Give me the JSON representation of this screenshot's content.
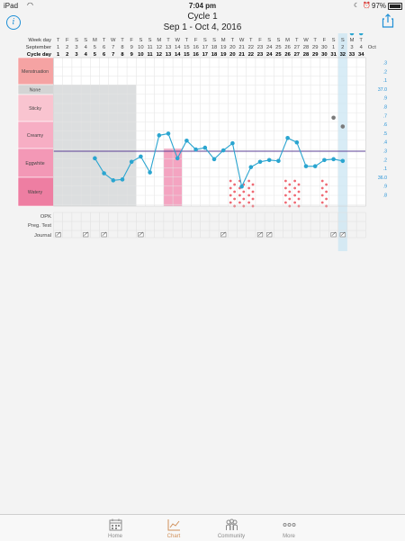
{
  "status_bar": {
    "device": "iPad",
    "time": "7:04 pm",
    "battery": "97%"
  },
  "header": {
    "title": "Cycle 1",
    "subtitle": "Sep 1 - Oct 4, 2016"
  },
  "chart_data": {
    "type": "line",
    "row_labels": {
      "week_day": "Week day",
      "month": "September",
      "cycle_day": "Cycle day"
    },
    "week_days": [
      "T",
      "F",
      "S",
      "S",
      "M",
      "T",
      "W",
      "T",
      "F",
      "S",
      "S",
      "M",
      "T",
      "W",
      "T",
      "F",
      "S",
      "S",
      "M",
      "T",
      "W",
      "T",
      "F",
      "S",
      "S",
      "M",
      "T",
      "W",
      "T",
      "F",
      "S",
      "S",
      "M",
      "T"
    ],
    "dates": [
      "1",
      "2",
      "3",
      "4",
      "5",
      "6",
      "7",
      "8",
      "9",
      "10",
      "11",
      "12",
      "13",
      "14",
      "15",
      "16",
      "17",
      "18",
      "19",
      "20",
      "21",
      "22",
      "23",
      "24",
      "25",
      "26",
      "27",
      "28",
      "29",
      "30",
      "1",
      "2",
      "3",
      "4"
    ],
    "next_month": "Oct",
    "cycle_days": [
      1,
      2,
      3,
      4,
      5,
      6,
      7,
      8,
      9,
      10,
      11,
      12,
      13,
      14,
      15,
      16,
      17,
      18,
      19,
      20,
      21,
      22,
      23,
      24,
      25,
      26,
      27,
      28,
      29,
      30,
      31,
      32,
      33,
      34
    ],
    "highlight_day": 32,
    "observation_categories": [
      "Menstruation",
      "None",
      "Sticky",
      "Creamy",
      "Eggwhite",
      "Watery"
    ],
    "observation_colors": {
      "Menstruation": "#f5a3a3",
      "None": "#d4d4d4",
      "Sticky": "#f9c4d0",
      "Creamy": "#f7aec4",
      "Eggwhite": "#f398b6",
      "Watery": "#ee7ea2"
    },
    "temperature_scale": [
      ".3",
      ".2",
      ".1",
      "37.0",
      ".9",
      ".8",
      ".7",
      ".6",
      ".5",
      ".4",
      ".3",
      ".2",
      ".1",
      "36.0",
      ".9",
      ".8"
    ],
    "temperature_series": {
      "name": "Temperature",
      "days": [
        5,
        6,
        7,
        8,
        9,
        10,
        11,
        12,
        13,
        14,
        15,
        16,
        17,
        18,
        19,
        20,
        21,
        22,
        23,
        24,
        25,
        26,
        27,
        28,
        29,
        30,
        31,
        32,
        33,
        34
      ],
      "values": [
        36.22,
        36.05,
        35.97,
        35.98,
        36.18,
        36.24,
        36.06,
        36.48,
        36.5,
        36.22,
        36.42,
        36.32,
        36.34,
        36.21,
        36.31,
        36.39,
        35.9,
        36.12,
        36.18,
        36.2,
        36.19,
        36.45,
        36.4,
        36.13,
        36.13,
        36.2,
        36.21,
        36.19
      ],
      "color": "#2aa5d0"
    },
    "stray_points": [
      {
        "day": 31,
        "value": 36.68
      },
      {
        "day": 32,
        "value": 36.58
      }
    ],
    "coverline": {
      "value": 36.3,
      "color": "#5b3f96"
    },
    "shaded_none_days": [
      1,
      9
    ],
    "pink_days": [
      13,
      14
    ],
    "watery_dot_days": [
      20,
      21,
      22,
      26,
      27,
      30
    ],
    "lower_rows": [
      "OPK",
      "Preg. Test",
      "Journal"
    ],
    "test_days": [
      1,
      4,
      6,
      10,
      19,
      23,
      24,
      31,
      32
    ]
  },
  "tabs": [
    {
      "label": "Home",
      "icon": "calendar-icon",
      "active": false
    },
    {
      "label": "Chart",
      "icon": "chart-icon",
      "active": true
    },
    {
      "label": "Community",
      "icon": "community-icon",
      "active": false
    },
    {
      "label": "More",
      "icon": "more-icon",
      "active": false
    }
  ],
  "colors": {
    "accent": "#1e8fd6",
    "active_tab": "#d0905a",
    "highlight_column": "#cbe6f3"
  }
}
